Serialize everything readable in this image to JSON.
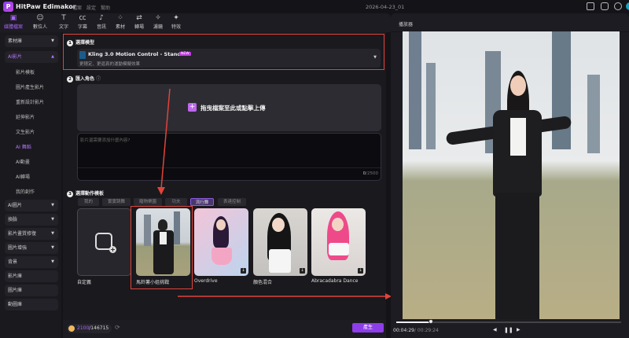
{
  "app": {
    "title": "HitPaw Edimakor",
    "menus": [
      "檔案",
      "設定",
      "幫助"
    ],
    "project_name": "2026-04-23_01"
  },
  "toolbar": [
    {
      "label": "媒體檔案",
      "icon": "media-icon",
      "active": true
    },
    {
      "label": "數位人",
      "icon": "avatar-icon"
    },
    {
      "label": "文字",
      "icon": "text-icon"
    },
    {
      "label": "字幕",
      "icon": "subtitle-icon"
    },
    {
      "label": "音訊",
      "icon": "music-icon"
    },
    {
      "label": "素材",
      "icon": "assets-icon"
    },
    {
      "label": "轉場",
      "icon": "transition-icon"
    },
    {
      "label": "濾鏡",
      "icon": "filter-icon"
    },
    {
      "label": "特效",
      "icon": "effects-icon"
    }
  ],
  "sidebar": {
    "groups_top": [
      {
        "label": "素材庫"
      },
      {
        "label": "AI影片"
      }
    ],
    "sub_items": [
      "影片模板",
      "圖片產生影片",
      "重新設計影片",
      "延伸影片",
      "文生影片",
      "AI 舞蹈",
      "AI動畫",
      "AI轉場",
      "我的創作"
    ],
    "active_sub": "AI 舞蹈",
    "groups_bottom": [
      {
        "label": "AI圖片",
        "caret": true
      },
      {
        "label": "換臉",
        "caret": true
      },
      {
        "label": "影片畫質修復",
        "caret": true
      },
      {
        "label": "圖片增強",
        "caret": true
      },
      {
        "label": "背景",
        "caret": true
      },
      {
        "label": "影片庫"
      },
      {
        "label": "圖片庫"
      },
      {
        "label": "動圖庫"
      }
    ]
  },
  "section1": {
    "number": "1",
    "title": "選擇模型",
    "model_name": "Kling 3.0 Motion Control - Standard",
    "badge": "NEW",
    "model_desc": "更穩定、更逼真的運動模擬效果"
  },
  "section2": {
    "number": "2",
    "title": "匯入角色",
    "upload_label": "拖曳檔案至此或點擊上傳",
    "prompt_placeholder": "影片還需要添加什麼內容?",
    "char_count": "0",
    "char_max": "/2500"
  },
  "section3": {
    "number": "3",
    "title": "選擇動作模板",
    "tabs": [
      "我的",
      "實實跳舞",
      "寵物樂園",
      "功夫",
      "流行舞",
      "表達控制"
    ],
    "active_tab": "流行舞",
    "templates": [
      "自定義",
      "馬鈴薯小姐挑戰",
      "Overdrive",
      "顏色混合",
      "Abracadabra Dance"
    ]
  },
  "bottom": {
    "credits_used": "2100",
    "credits_total": "/146715",
    "generate_label": "產生"
  },
  "preview": {
    "title": "播放器",
    "current_time": "00:04:29",
    "total_time": "/ 00:29:24",
    "progress": 0.154
  },
  "colors": {
    "accent": "#a765f5",
    "highlight": "#e0443a"
  }
}
